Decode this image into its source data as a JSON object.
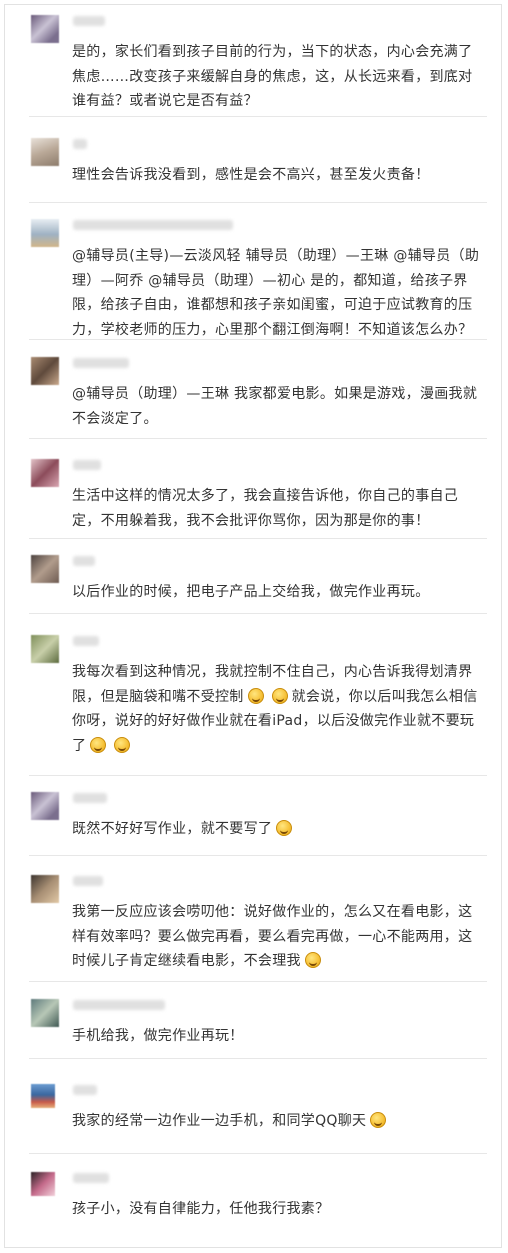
{
  "colors": {
    "text": "#333333",
    "divider": "#e7e7e7",
    "background": "#ffffff"
  },
  "comments": [
    {
      "text": "是的，家长们看到孩子目前的行为，当下的状态，内心会充满了焦虑……改变孩子来缓解自身的焦虑，这，从长远来看，到底对谁有益？或者说它是否有益？"
    },
    {
      "text": "理性会告诉我没看到，感性是会不高兴，甚至发火责备！"
    },
    {
      "text": "@辅导员(主导)—云淡风轻 辅导员（助理）—王琳 @辅导员（助理）—阿乔 @辅导员（助理）—初心 是的，都知道，给孩子界限，给孩子自由，谁都想和孩子亲如闺蜜，可迫于应试教育的压力，学校老师的压力，心里那个翻江倒海啊！不知道该怎么办？"
    },
    {
      "text": "@辅导员（助理）—王琳 我家都爱电影。如果是游戏，漫画我就不会淡定了。"
    },
    {
      "text": "生活中这样的情况太多了，我会直接告诉他，你自己的事自己定，不用躲着我，我不会批评你骂你，因为那是你的事！"
    },
    {
      "text": "以后作业的时候，把电子产品上交给我，做完作业再玩。"
    },
    {
      "text_a": "我每次看到这种情况，我就控制不住自己，内心告诉我得划清界限，但是脑袋和嘴不受控制",
      "text_b": "就会说，你以后叫我怎么相信你呀，说好的好好做作业就在看iPad，以后没做完作业就不要玩了"
    },
    {
      "text": "既然不好好写作业，就不要写了"
    },
    {
      "text": "我第一反应应该会唠叨他：说好做作业的，怎么又在看电影，这样有效率吗？要么做完再看，要么看完再做，一心不能两用，这时候儿子肯定继续看电影，不会理我"
    },
    {
      "text": "手机给我，做完作业再玩！"
    },
    {
      "text": "我家的经常一边作业一边手机，和同学QQ聊天"
    },
    {
      "text": "孩子小，没有自律能力，任他我行我素？"
    }
  ]
}
